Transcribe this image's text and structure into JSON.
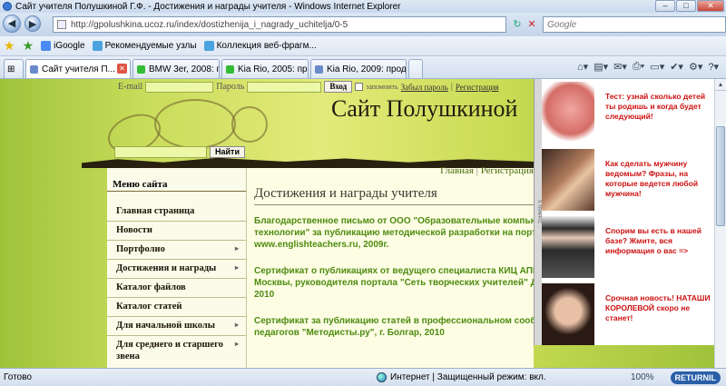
{
  "window": {
    "title": "Сайт учителя Полушкиной Г.Ф. - Достижения и награды учителя - Windows Internet Explorer"
  },
  "address": {
    "url": "http://gpolushkina.ucoz.ru/index/dostizhenija_i_nagrady_uchitelja/0-5",
    "search_placeholder": "Google"
  },
  "favorites": {
    "items": [
      "iGoogle",
      "Рекомендуемые узлы",
      "Коллекция веб-фрагм..."
    ]
  },
  "tabs": [
    {
      "label": "Сайт учителя П...",
      "active": true
    },
    {
      "label": "BMW 3er, 2008: пр...",
      "active": false
    },
    {
      "label": "Kia Rio, 2005: прод...",
      "active": false
    },
    {
      "label": "Kia Rio, 2009: прод...",
      "active": false
    }
  ],
  "site": {
    "login": {
      "email_label": "E-mail",
      "password_label": "Пароль",
      "button": "Вход",
      "remember": "запомнить",
      "forgot": "Забыл пароль",
      "register": "Регистрация"
    },
    "title": "Сайт Полушкиной",
    "search_button": "Найти",
    "menu_title": "Меню сайта",
    "menu": [
      {
        "label": "Главная страница"
      },
      {
        "label": "Новости"
      },
      {
        "label": "Портфолио"
      },
      {
        "label": "Достижения и награды"
      },
      {
        "label": "Каталог файлов"
      },
      {
        "label": "Каталог статей"
      },
      {
        "label": "Для начальной школы"
      },
      {
        "label": "Для среднего и старшего звена"
      }
    ],
    "breadcrumb": {
      "home": "Главная",
      "sep": "|",
      "register": "Регистрация"
    },
    "page_title": "Достижения и награды учителя",
    "achievements": [
      "Благодарственное письмо от ООО \"Образовательные компьют",
      "технологии\" за публикацию методической разработки на портал",
      "www.englishteachers.ru, 2009г.",
      "Сертификат о публикациях от ведущего специалиста КИЦ АПК г.",
      "Москвы, руководителя портала \"Сеть творческих учителей\" Др",
      "2010",
      "Сертификат за публикацию статей в профессиональном сообщ",
      "педагогов \"Методисты.ру\", г. Болгар, 2010"
    ]
  },
  "ads": [
    {
      "text": "Тест: узнай сколько детей ты родишь и когда будет следующий!",
      "icon": "pregnancy-image"
    },
    {
      "text": "Как сделать мужчину ведомым? Фразы, на которые ведется любой мужчина!",
      "icon": "couple-image"
    },
    {
      "text": "Спорим вы есть в нашей базе? Жмите, вся информация о вас =>",
      "icon": "woman-phone-image"
    },
    {
      "text": "Срочная новость! НАТАШИ КОРОЛЕВОЙ скоро не станет!",
      "icon": "celebrity-image"
    }
  ],
  "ads_sidebar_label": "X-TRAFFIC",
  "status": {
    "left": "Готово",
    "zone": "Интернет | Защищенный режим: вкл.",
    "zoom": "100%",
    "badge": "RETURNIL"
  }
}
